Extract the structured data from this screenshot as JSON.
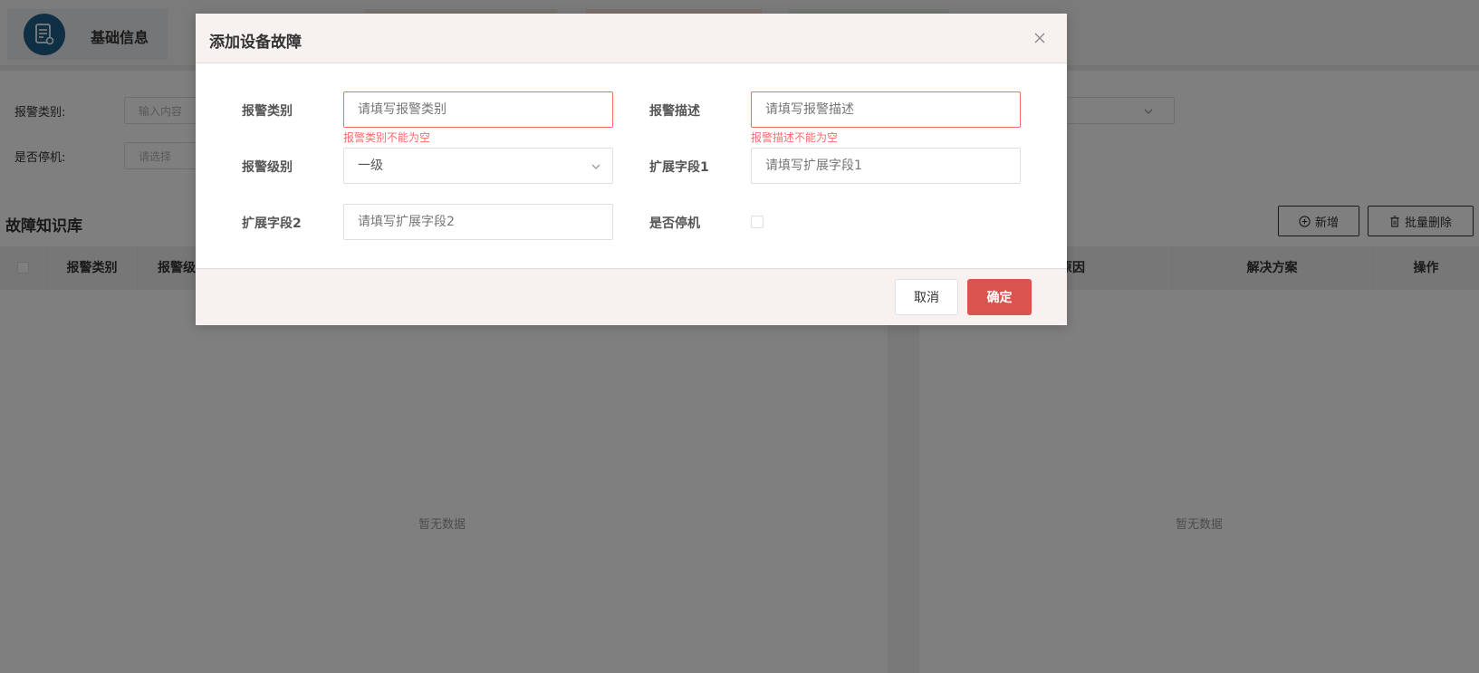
{
  "top_tabs": {
    "active_label": "基础信息"
  },
  "filter": {
    "alarm_category_label": "报警类别:",
    "alarm_category_placeholder": "输入内容",
    "stop_label": "是否停机:",
    "stop_placeholder": "请选择"
  },
  "knowledge_base": {
    "title": "故障知识库",
    "add_button": "新增",
    "batch_delete_button": "批量删除",
    "columns": {
      "alarm_category": "报警类别",
      "alarm_level": "报警级",
      "cause": "原因",
      "solution": "解决方案",
      "operation": "操作"
    },
    "empty_left": "暂无数据",
    "empty_right": "暂无数据"
  },
  "dialog": {
    "title": "添加设备故障",
    "fields": {
      "alarm_category": {
        "label": "报警类别",
        "placeholder": "请填写报警类别",
        "error": "报警类别不能为空"
      },
      "alarm_description": {
        "label": "报警描述",
        "placeholder": "请填写报警描述",
        "error": "报警描述不能为空"
      },
      "alarm_level": {
        "label": "报警级别",
        "value": "一级"
      },
      "ext_field_1": {
        "label": "扩展字段1",
        "placeholder": "请填写扩展字段1"
      },
      "ext_field_2": {
        "label": "扩展字段2",
        "placeholder": "请填写扩展字段2"
      },
      "is_stop": {
        "label": "是否停机"
      }
    },
    "cancel_button": "取消",
    "confirm_button": "确定"
  },
  "colors": {
    "primary_button": "#d9534f",
    "error": "#f56c6c",
    "icon_bg": "#1f5f8b"
  }
}
